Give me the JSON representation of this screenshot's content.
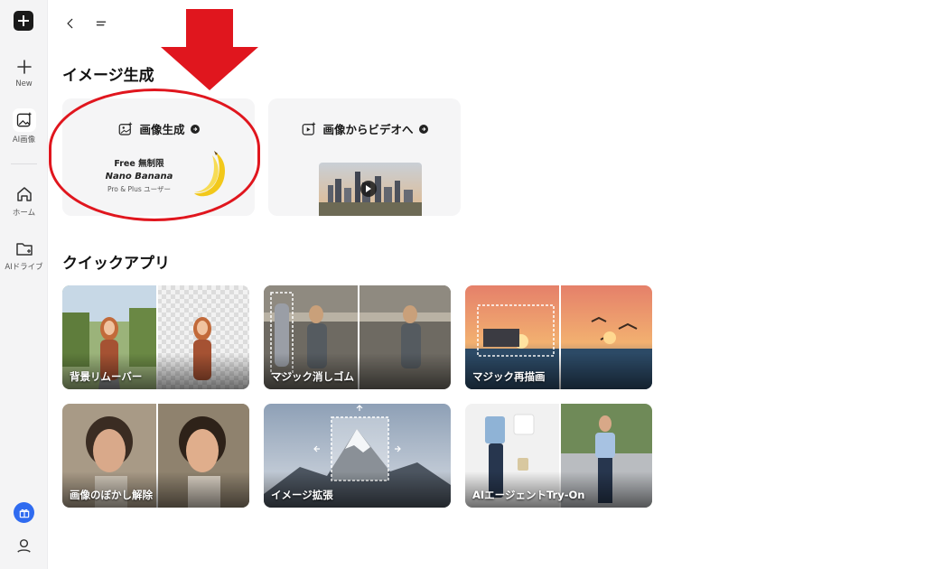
{
  "sidebar": {
    "new_label": "New",
    "ai_image_label": "AI画像",
    "home_label": "ホーム",
    "ai_drive_label": "AIドライブ",
    "icons": [
      "logo-icon",
      "plus-icon",
      "ai-image-icon",
      "home-icon",
      "folder-icon",
      "gift-icon",
      "user-icon"
    ]
  },
  "topbar": {
    "icons": [
      "back-icon",
      "menu-icon"
    ]
  },
  "image_generation": {
    "title": "イメージ生成",
    "cards": [
      {
        "title": "画像生成",
        "promo_line1": "Free 無制限",
        "promo_line2": "Nano Banana",
        "promo_line3": "Pro & Plus ユーザー"
      },
      {
        "title": "画像からビデオへ"
      }
    ]
  },
  "quick_apps": {
    "title": "クイックアプリ",
    "items": [
      {
        "label": "背景リムーバー"
      },
      {
        "label": "マジック消しゴム"
      },
      {
        "label": "マジック再描画"
      },
      {
        "label": "画像のぼかし解除"
      },
      {
        "label": "イメージ拡張"
      },
      {
        "label": "AIエージェントTry-On"
      }
    ]
  },
  "colors": {
    "accent": "#2f6bf0",
    "annotation_red": "#e0161e",
    "card_bg": "#f5f5f6",
    "sidebar_bg": "#f4f4f5"
  }
}
